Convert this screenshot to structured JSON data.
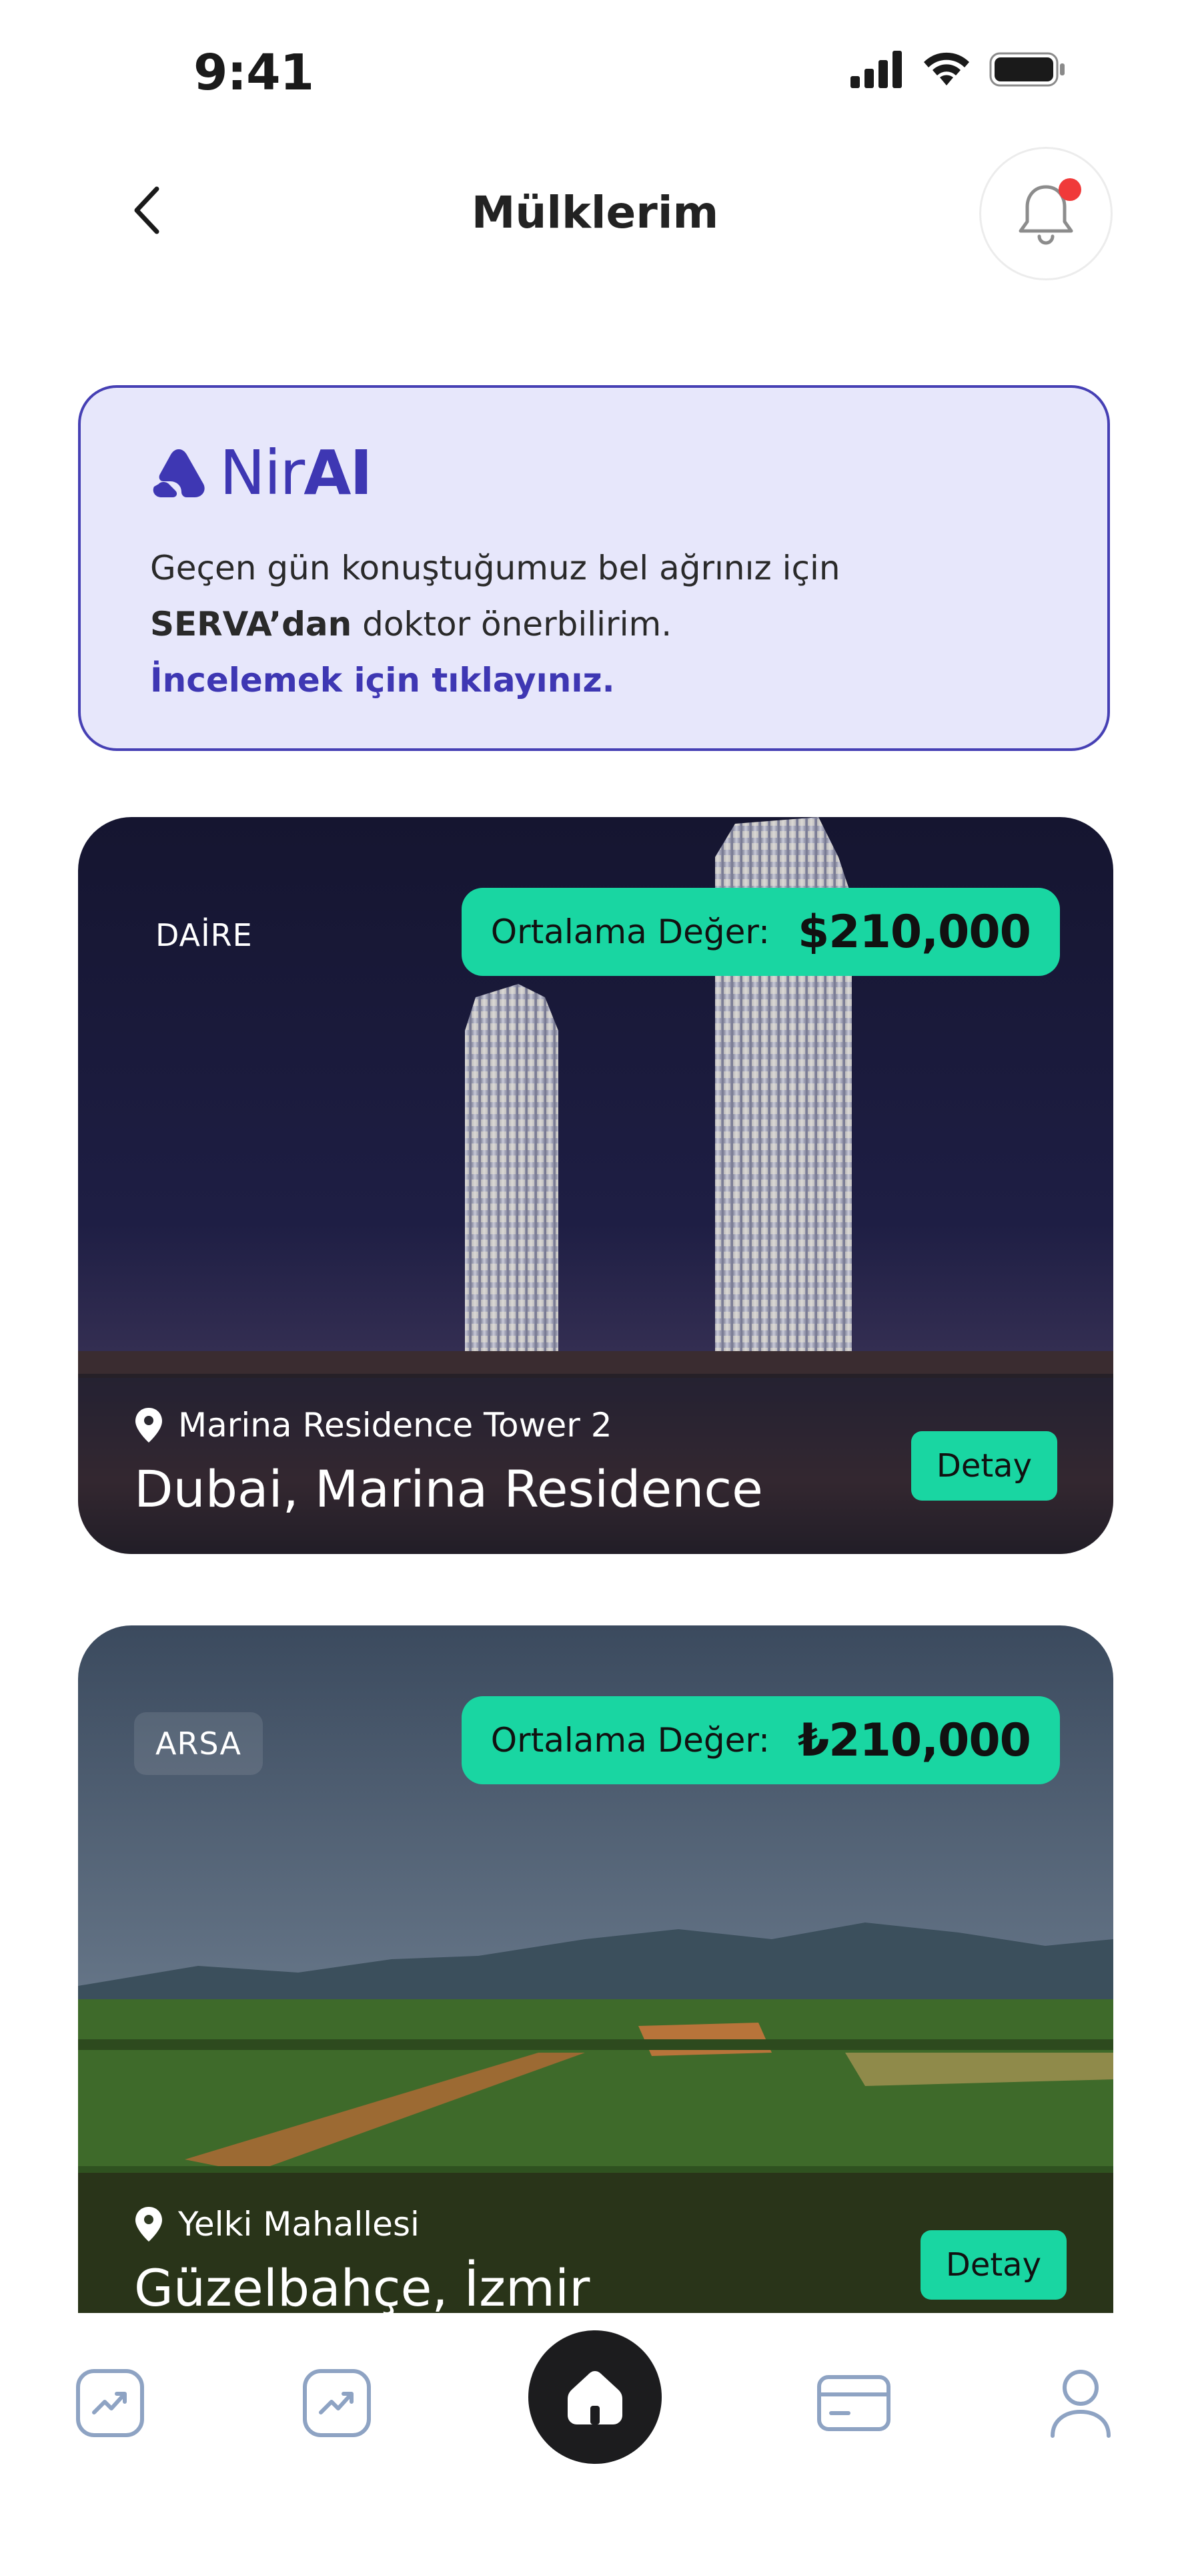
{
  "status_bar": {
    "time": "9:41"
  },
  "header": {
    "title": "Mülklerim"
  },
  "ai_card": {
    "logo_light": "Nir",
    "logo_bold": "AI",
    "text_part1": "Geçen gün konuştuğumuz bel ağrınız için",
    "text_bold": "SERVA’dan",
    "text_part2": " doktor önerbilirim.",
    "link": "İncelemek için tıklayınız.",
    "accent_color": "#3e37b3",
    "background_color": "#e7e7fb"
  },
  "properties": [
    {
      "type": "DAİRE",
      "price_label": "Ortalama Değer:",
      "price_value": "$210,000",
      "location": "Marina Residence Tower 2",
      "name": "Dubai, Marina Residence",
      "detail_label": "Detay"
    },
    {
      "type": "ARSA",
      "price_label": "Ortalama Değer:",
      "price_value": "₺210,000",
      "location": "Yelki Mahallesi",
      "name": "Güzelbahçe, İzmir",
      "detail_label": "Detay"
    }
  ],
  "bottom_nav": {
    "items": [
      "chart-up-icon",
      "chart-up-icon",
      "home-icon",
      "card-icon",
      "user-icon"
    ],
    "active": "home-icon"
  },
  "colors": {
    "accent_green": "#19d6a2",
    "notification_dot": "#f03a3a",
    "nav_icon": "#8ea3c3"
  }
}
